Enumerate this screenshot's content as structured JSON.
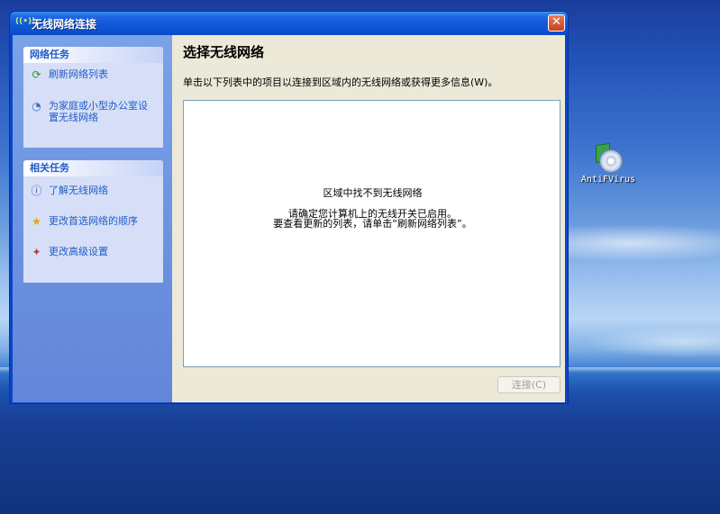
{
  "window": {
    "title": "无线网络连接",
    "close_glyph": "✕"
  },
  "sidebar": {
    "network_tasks": {
      "heading": "网络任务",
      "items": [
        {
          "label": "刷新网络列表",
          "icon": "refresh-icon"
        },
        {
          "label": "为家庭或小型办公室设置无线网络",
          "icon": "wireless-setup-icon"
        }
      ]
    },
    "related_tasks": {
      "heading": "相关任务",
      "items": [
        {
          "label": "了解无线网络",
          "icon": "info-icon"
        },
        {
          "label": "更改首选网络的顺序",
          "icon": "star-icon"
        },
        {
          "label": "更改高级设置",
          "icon": "settings-icon"
        }
      ]
    }
  },
  "main": {
    "title": "选择无线网络",
    "description": "单击以下列表中的项目以连接到区域内的无线网络或获得更多信息(W)。",
    "list": {
      "empty_message": "区域中找不到无线网络",
      "hint_line1": "请确定您计算机上的无线开关已启用。",
      "hint_line2": "要查看更新的列表，请单击“刷新网络列表”。"
    },
    "connect_label": "连接(C)"
  },
  "desktop": {
    "icon_label": "AntiFVirus"
  },
  "colors": {
    "titlebar": "#0b4bc5",
    "taskpane": "#6b91e0",
    "link": "#215dc6"
  }
}
